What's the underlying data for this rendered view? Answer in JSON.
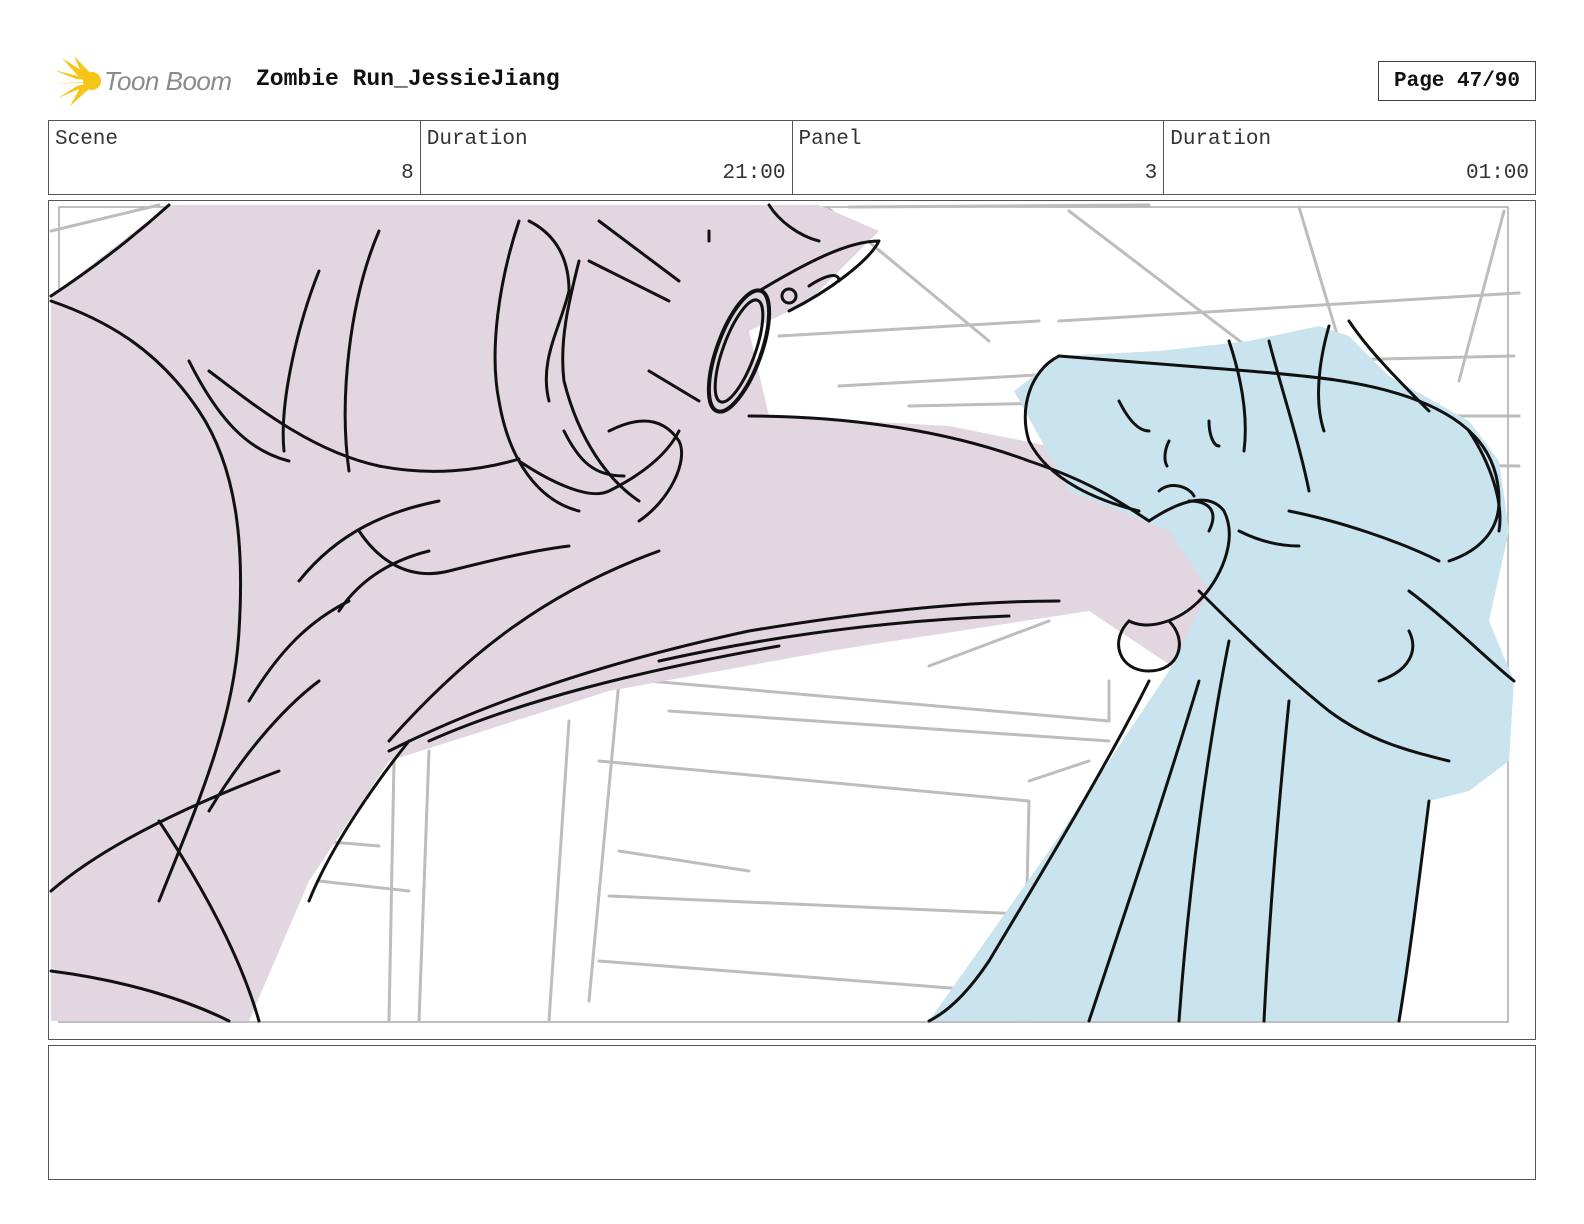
{
  "header": {
    "logo_text": "Toon Boom",
    "project_title": "Zombie Run_JessieJiang",
    "page_label": "Page 47/90"
  },
  "info": {
    "scene_label": "Scene",
    "scene_value": "8",
    "scene_duration_label": "Duration",
    "scene_duration_value": "21:00",
    "panel_label": "Panel",
    "panel_value": "3",
    "panel_duration_label": "Duration",
    "panel_duration_value": "01:00"
  },
  "colors": {
    "logo_yellow": "#f5c518",
    "character_left_fill": "#e2d6e1",
    "character_right_fill": "#c9e4ee",
    "background_lines": "#bdbdbd",
    "ink": "#111111"
  },
  "notes": {
    "text": ""
  }
}
